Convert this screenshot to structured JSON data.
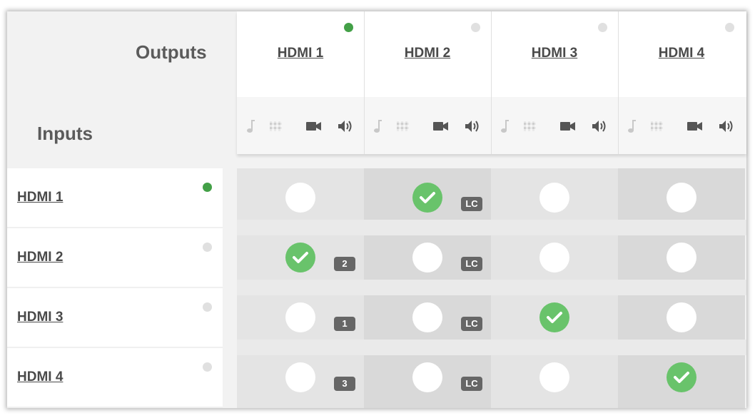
{
  "labels": {
    "outputs": "Outputs",
    "inputs": "Inputs"
  },
  "colors": {
    "active_dot": "#43a047",
    "inactive_dot": "#e0e0e0",
    "check": "#69c36b",
    "badge": "#666666"
  },
  "outputs": [
    {
      "name": "HDMI 1",
      "active": true
    },
    {
      "name": "HDMI 2",
      "active": false
    },
    {
      "name": "HDMI 3",
      "active": false
    },
    {
      "name": "HDMI 4",
      "active": false
    }
  ],
  "output_icons": [
    "music-note-icon",
    "test-pattern-icon",
    "video-camera-icon",
    "speaker-icon"
  ],
  "inputs": [
    {
      "name": "HDMI 1",
      "active": true
    },
    {
      "name": "HDMI 2",
      "active": false
    },
    {
      "name": "HDMI 3",
      "active": false
    },
    {
      "name": "HDMI 4",
      "active": false
    }
  ],
  "matrix": [
    [
      {
        "checked": false,
        "badge": ""
      },
      {
        "checked": true,
        "badge": "LC"
      },
      {
        "checked": false,
        "badge": ""
      },
      {
        "checked": false,
        "badge": ""
      }
    ],
    [
      {
        "checked": true,
        "badge": "2"
      },
      {
        "checked": false,
        "badge": "LC"
      },
      {
        "checked": false,
        "badge": ""
      },
      {
        "checked": false,
        "badge": ""
      }
    ],
    [
      {
        "checked": false,
        "badge": "1"
      },
      {
        "checked": false,
        "badge": "LC"
      },
      {
        "checked": true,
        "badge": ""
      },
      {
        "checked": false,
        "badge": ""
      }
    ],
    [
      {
        "checked": false,
        "badge": "3"
      },
      {
        "checked": false,
        "badge": "LC"
      },
      {
        "checked": false,
        "badge": ""
      },
      {
        "checked": true,
        "badge": ""
      }
    ]
  ]
}
